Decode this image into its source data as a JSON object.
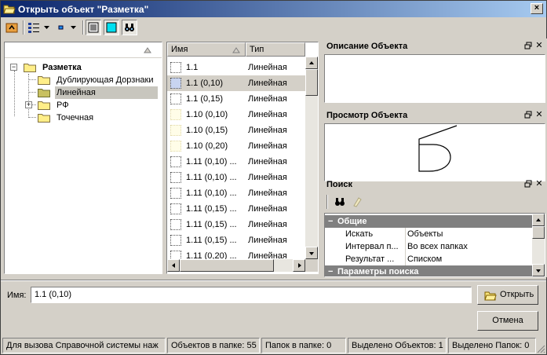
{
  "window": {
    "title": "Открыть объект \"Разметка\""
  },
  "tree": {
    "items": [
      {
        "label": "Разметка"
      },
      {
        "label": "Дублирующая Дорзнаки"
      },
      {
        "label": "Линейная"
      },
      {
        "label": "РФ"
      },
      {
        "label": "Точечная"
      }
    ]
  },
  "list": {
    "columns": [
      "Имя",
      "Тип"
    ],
    "rows": [
      {
        "name": "1.1",
        "type": "Линейная"
      },
      {
        "name": "1.1 (0,10)",
        "type": "Линейная"
      },
      {
        "name": "1.1 (0,15)",
        "type": "Линейная"
      },
      {
        "name": "1.10 (0,10)",
        "type": "Линейная"
      },
      {
        "name": "1.10 (0,15)",
        "type": "Линейная"
      },
      {
        "name": "1.10 (0,20)",
        "type": "Линейная"
      },
      {
        "name": "1.11 (0,10) ...",
        "type": "Линейная"
      },
      {
        "name": "1.11 (0,10) ...",
        "type": "Линейная"
      },
      {
        "name": "1.11 (0,10) ...",
        "type": "Линейная"
      },
      {
        "name": "1.11 (0,15) ...",
        "type": "Линейная"
      },
      {
        "name": "1.11 (0,15) ...",
        "type": "Линейная"
      },
      {
        "name": "1.11 (0,15) ...",
        "type": "Линейная"
      },
      {
        "name": "1.11 (0,20) ...",
        "type": "Линейная"
      }
    ]
  },
  "panels": {
    "description": {
      "title": "Описание Объекта"
    },
    "preview": {
      "title": "Просмотр Объекта"
    },
    "search": {
      "title": "Поиск",
      "category_general": "Общие",
      "props": [
        {
          "key": "Искать",
          "value": "Объекты"
        },
        {
          "key": "Интервал п...",
          "value": "Во всех папках"
        },
        {
          "key": "Результат ...",
          "value": "Списком"
        }
      ],
      "category_params": "Параметры поиска"
    }
  },
  "name_field": {
    "label": "Имя:",
    "value": "1.1 (0,10)"
  },
  "buttons": {
    "open": "Открыть",
    "cancel": "Отмена"
  },
  "statusbar": {
    "help": "Для вызова Справочной системы наж",
    "objects_in_folder": "Объектов в папке: 55",
    "folders_in_folder": "Папок в папке: 0",
    "selected_objects": "Выделено Объектов: 1",
    "selected_folders": "Выделено Папок: 0"
  },
  "colors": {
    "title_start": "#0a246a",
    "title_end": "#a6caf0",
    "face": "#d4d0c8",
    "category": "#808080"
  }
}
